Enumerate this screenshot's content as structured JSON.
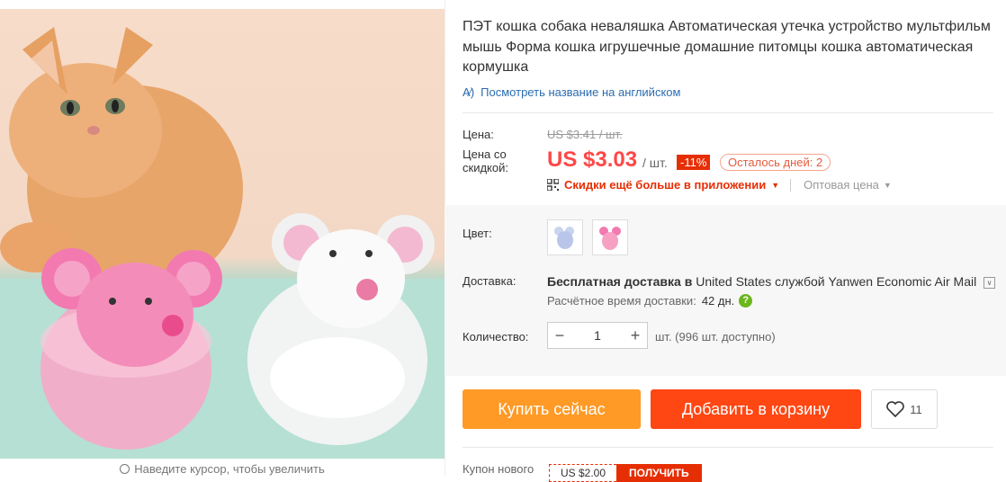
{
  "gallery": {
    "zoom_hint": "Наведите курсор, чтобы увеличить"
  },
  "product": {
    "title": "ПЭТ кошка собака неваляшка Автоматическая утечка устройство мультфильм мышь Форма кошка игрушечные домашние питомцы кошка автоматическая кормушка",
    "translate_link": "Посмотреть название на английском"
  },
  "price": {
    "label": "Цена:",
    "old": "US $3.41 / шт.",
    "discount_label": "Цена со скидкой:",
    "current": "US $3.03",
    "per": "/ шт.",
    "discount_badge": "-11%",
    "days_left": "Осталось дней: 2",
    "app_link": "Скидки ещё больше в приложении",
    "wholesale": "Оптовая цена"
  },
  "color": {
    "label": "Цвет:",
    "options": [
      "white-mouse",
      "pink-mouse"
    ]
  },
  "shipping": {
    "label": "Доставка:",
    "main_prefix": "Бесплатная доставка в",
    "main_suffix": "United States службой Yanwen Economic Air Mail",
    "time_label": "Расчётное время доставки:",
    "time_value": "42 дн."
  },
  "quantity": {
    "label": "Количество:",
    "value": "1",
    "note": "шт. (996 шт. доступно)"
  },
  "actions": {
    "buy_now": "Купить сейчас",
    "add_to_cart": "Добавить в корзину",
    "wishlist_count": "11"
  },
  "coupon": {
    "label": "Купон нового",
    "value": "US $2.00",
    "get": "ПОЛУЧИТЬ"
  },
  "colors": {
    "price_red": "#ff4747",
    "buy_orange": "#ff9a26",
    "cart_red": "#ff4713",
    "link_blue": "#2b6cb0"
  }
}
